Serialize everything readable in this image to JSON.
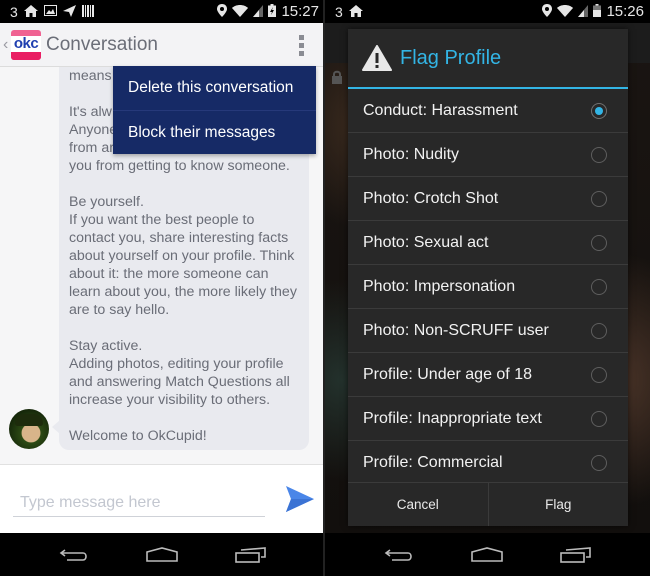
{
  "left_screen": {
    "status_bar": {
      "notification_count": "3",
      "icons_left": [
        "home-icon",
        "image-icon",
        "send-icon",
        "barcode-icon"
      ],
      "icons_right": [
        "location-icon",
        "wifi-icon",
        "signal-icon",
        "battery-charging-icon"
      ],
      "time": "15:27"
    },
    "action_bar": {
      "logo_text": "okc",
      "title": "Conversation"
    },
    "overflow_menu": {
      "items": [
        {
          "label": "Delete this conversation"
        },
        {
          "label": "Block their messages"
        }
      ]
    },
    "message": {
      "paragraphs": [
        "means",
        "It's alw\nAnyone\nfrom ar\nyou from getting to know someone.",
        "Be yourself.\nIf you want the best people to contact you, share interesting facts about yourself on your profile. Think about it: the more someone can learn about you, the more likely they are to say hello.",
        "Stay active.\nAdding photos, editing your profile and answering Match Questions all increase your visibility to others.",
        "Welcome to OkCupid!"
      ]
    },
    "compose": {
      "placeholder": "Type message here",
      "value": ""
    },
    "colors": {
      "menu_bg": "#162a66",
      "send_icon": "#4a86e8",
      "logo_pink": "#f06292"
    }
  },
  "right_screen": {
    "status_bar": {
      "notification_count": "3",
      "icons_left": [
        "home-icon"
      ],
      "icons_right": [
        "location-icon",
        "wifi-icon",
        "signal-icon",
        "battery-icon"
      ],
      "time": "15:26"
    },
    "dialog": {
      "title": "Flag Profile",
      "options": [
        {
          "label": "Conduct: Harassment",
          "selected": true
        },
        {
          "label": "Photo: Nudity",
          "selected": false
        },
        {
          "label": "Photo: Crotch Shot",
          "selected": false
        },
        {
          "label": "Photo: Sexual act",
          "selected": false
        },
        {
          "label": "Photo: Impersonation",
          "selected": false
        },
        {
          "label": "Photo: Non-SCRUFF user",
          "selected": false
        },
        {
          "label": "Profile: Under age of 18",
          "selected": false
        },
        {
          "label": "Profile: Inappropriate text",
          "selected": false
        },
        {
          "label": "Profile: Commercial",
          "selected": false
        }
      ],
      "buttons": {
        "cancel": "Cancel",
        "confirm": "Flag"
      }
    },
    "colors": {
      "accent": "#33b5e5",
      "dialog_bg": "#282828"
    }
  },
  "nav_bar": {
    "buttons": [
      "back",
      "home",
      "recents"
    ]
  }
}
